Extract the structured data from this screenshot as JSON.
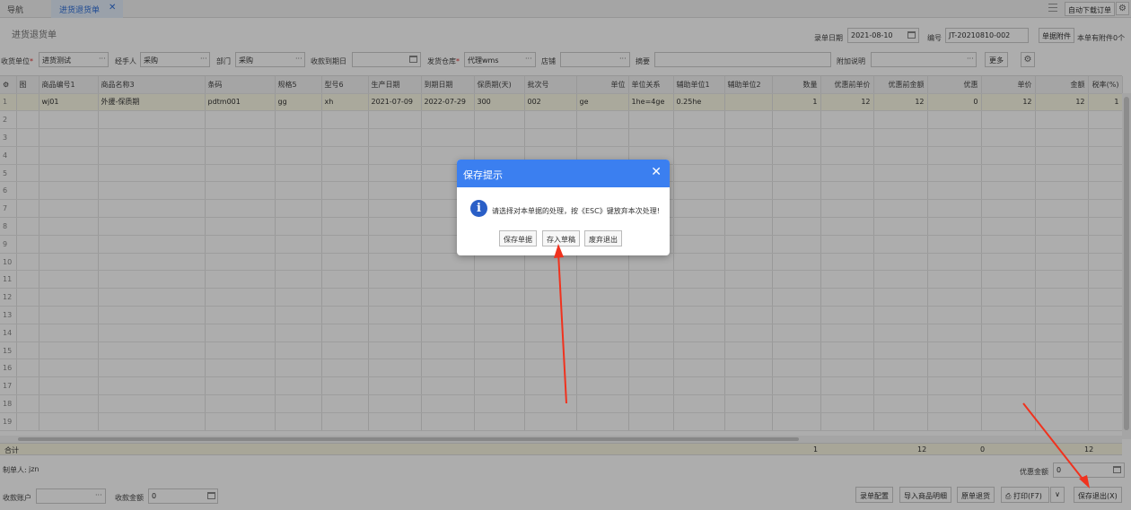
{
  "tabs": {
    "nav": "导航",
    "active": "进货退货单",
    "close": "✕"
  },
  "topbar": {
    "auto_order": "自动下载订单"
  },
  "page_title": "进货退货单",
  "header": {
    "entry_date_label": "录单日期",
    "entry_date_value": "2021-08-10",
    "number_label": "编号",
    "number_value": "JT-20210810-002",
    "attachment_btn": "单据附件",
    "attachment_status": "本单有附件0个"
  },
  "filters": {
    "supplier_label": "收货单位",
    "supplier_value": "进货测试",
    "handler_label": "经手人",
    "handler_value": "采购",
    "dept_label": "部门",
    "dept_value": "采购",
    "due_label": "收款到期日",
    "warehouse_label": "发货仓库",
    "warehouse_value": "代理wms",
    "store_label": "店铺",
    "summary_label": "摘要",
    "note_label": "附加说明",
    "more_btn": "更多"
  },
  "grid": {
    "headers": [
      "",
      "图",
      "商品编号1",
      "商品名称3",
      "条码",
      "规格5",
      "型号6",
      "生产日期",
      "到期日期",
      "保质期(天)",
      "批次号",
      "单位",
      "单位关系",
      "辅助单位1",
      "辅助单位2",
      "数量",
      "优惠前单价",
      "优惠前金额",
      "优惠",
      "单价",
      "金额",
      "税率(%)"
    ],
    "row1": [
      "1",
      "",
      "wj01",
      "外援-保质期",
      "pdtm001",
      "gg",
      "xh",
      "2021-07-09",
      "2022-07-29",
      "300",
      "002",
      "ge",
      "1he=4ge",
      "0.25he",
      "",
      "1",
      "12",
      "12",
      "0",
      "12",
      "12",
      "1"
    ],
    "row_numbers": [
      "2",
      "3",
      "4",
      "5",
      "6",
      "7",
      "8",
      "9",
      "10",
      "11",
      "12",
      "13",
      "14",
      "15",
      "16",
      "17",
      "18",
      "19"
    ],
    "total_label": "合计",
    "total_qty": "1",
    "total_amount_before": "12",
    "total_discount": "0",
    "total_amount": "12"
  },
  "footer": {
    "creator_label": "制单人:",
    "creator_value": "jzn",
    "discount_total_label": "优惠金额",
    "discount_total_value": "0",
    "account_label": "收款账户",
    "received_label": "收款金额",
    "received_value": "0",
    "btn_config": "录单配置",
    "btn_import": "导入商品明细",
    "btn_return": "原单退货",
    "btn_print": "打印(F7)",
    "btn_save_exit": "保存退出(X)"
  },
  "dialog": {
    "title": "保存提示",
    "message": "请选择对本单据的处理，按《ESC》键放弃本次处理!",
    "btn_save": "保存单据",
    "btn_draft": "存入草稿",
    "btn_discard": "废弃退出"
  },
  "colors": {
    "accent": "#3b7ff0",
    "arrow": "#f0321e",
    "row_highlight": "#fbf9e6"
  }
}
